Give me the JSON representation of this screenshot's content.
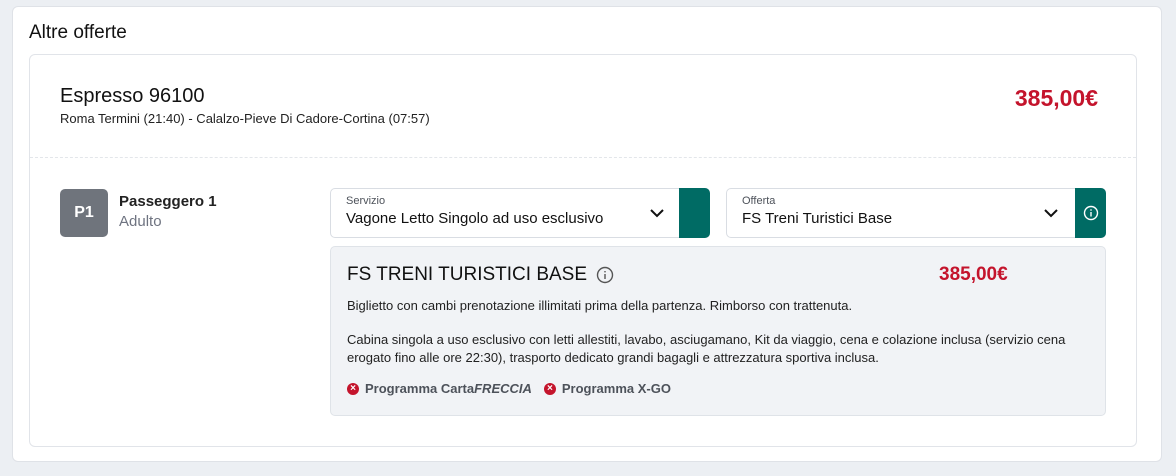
{
  "section": {
    "title": "Altre offerte"
  },
  "train": {
    "name": "Espresso 96100",
    "route": "Roma Termini (21:40) - Calalzo-Pieve Di Cadore-Cortina (07:57)",
    "price": "385,00€"
  },
  "passenger": {
    "badge": "P1",
    "name": "Passeggero 1",
    "type": "Adulto"
  },
  "servizio": {
    "label": "Servizio",
    "value": "Vagone Letto Singolo ad uso esclusivo"
  },
  "offerta": {
    "label": "Offerta",
    "value": "FS Treni Turistici Base"
  },
  "offer_detail": {
    "title": "FS TRENI TURISTICI BASE",
    "price": "385,00€",
    "desc1": "Biglietto con cambi prenotazione illimitati prima della partenza. Rimborso con trattenuta.",
    "desc2": "Cabina singola a uso esclusivo con letti allestiti, lavabo, asciugamano, Kit da viaggio, cena e colazione inclusa (servizio cena erogato fino alle ore 22:30), trasporto dedicato grandi bagagli e attrezzatura sportiva inclusa.",
    "programs": [
      {
        "prefix": "Programma Carta",
        "suffix": "FRECCIA"
      },
      {
        "prefix": "Programma X-GO",
        "suffix": ""
      }
    ]
  },
  "colors": {
    "accent_red": "#c4142c",
    "teal": "#006b64",
    "badge_gray": "#6f747c"
  },
  "icons": [
    "chevron-down-icon",
    "info-icon",
    "x-circle-icon"
  ]
}
